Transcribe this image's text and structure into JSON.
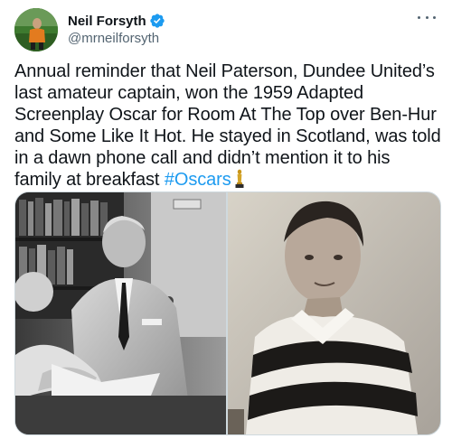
{
  "author": {
    "display_name": "Neil Forsyth",
    "handle": "@mrneilforsyth",
    "verified_icon": "verified-badge-icon",
    "verified_color": "#1d9bf0"
  },
  "tweet": {
    "text_main": "Annual reminder that Neil Paterson, Dundee United’s last amateur captain, won the 1959 Adapted Screenplay Oscar for Room At The Top over Ben-Hur and Some Like It Hot. He stayed in Scotland, was told in a dawn phone call and didn’t mention it to his family at breakfast ",
    "hashtag": "#Oscars",
    "trailing_emoji": "oscar-trophy-icon"
  },
  "media": {
    "photos": [
      {
        "subject": "man-at-desk-photo"
      },
      {
        "subject": "footballer-portrait-photo"
      }
    ]
  },
  "colors": {
    "text": "#0f1419",
    "secondary": "#536471",
    "link": "#1d9bf0",
    "border": "#cfd9de"
  },
  "icons": {
    "more": "more-options-icon"
  }
}
